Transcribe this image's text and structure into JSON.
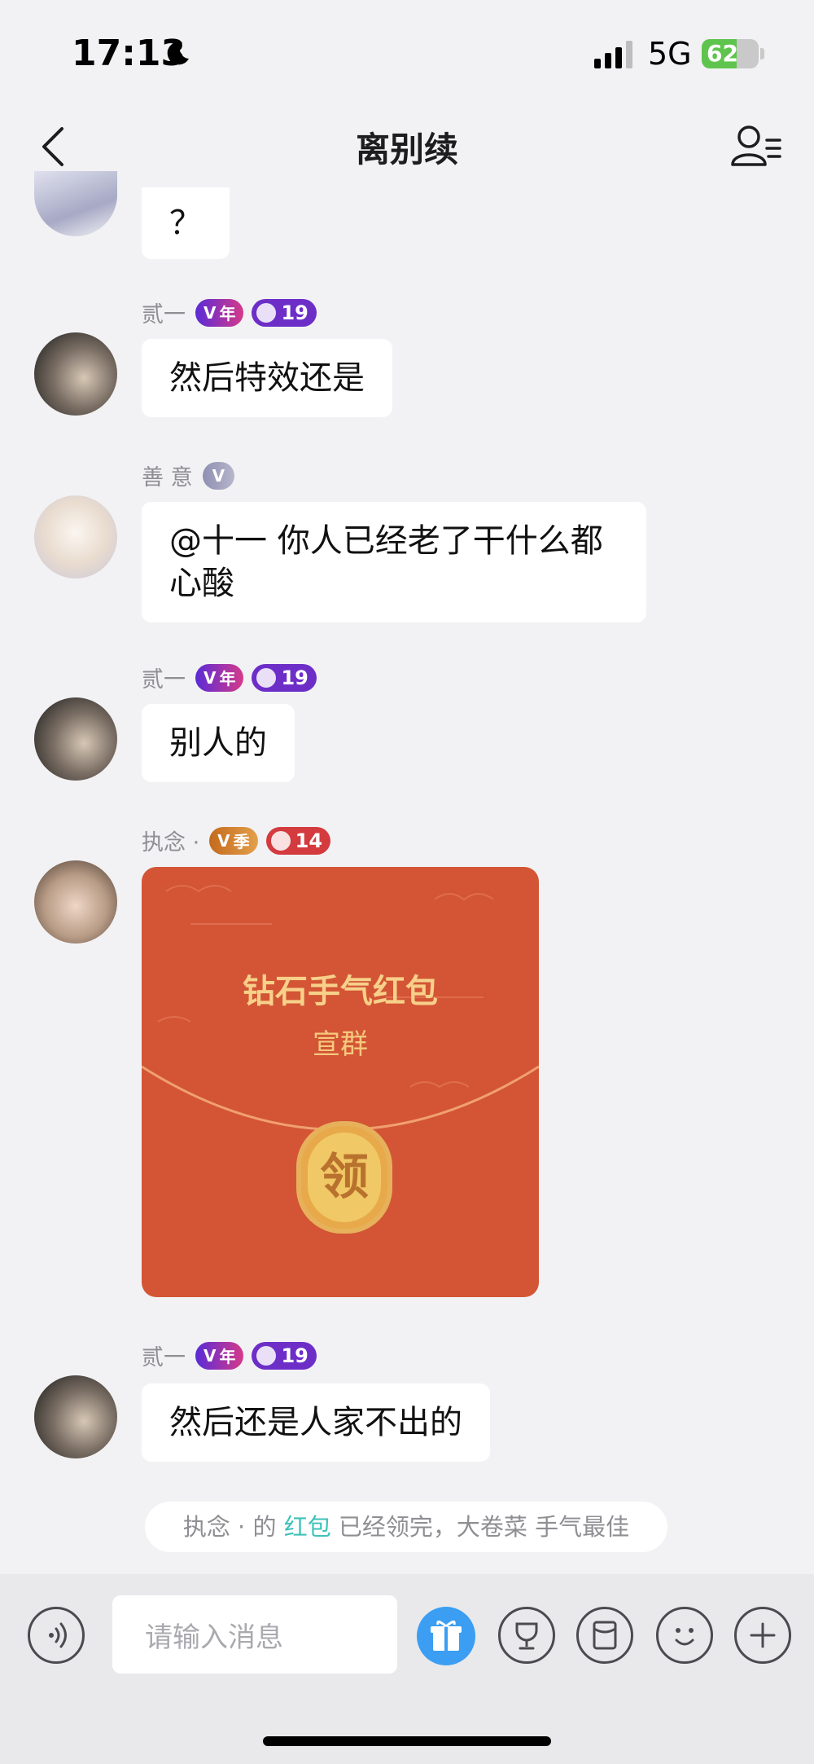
{
  "status_bar": {
    "time": "17:13",
    "network": "5G",
    "battery": "62"
  },
  "nav": {
    "title": "离别续"
  },
  "messages": [
    {
      "bubble": "？"
    },
    {
      "sender": "贰一",
      "vip_tag": "年",
      "level": "19",
      "bubble": "然后特效还是"
    },
    {
      "sender": "善 意",
      "bubble_l1": "@十一 你人已经老了干什么都",
      "bubble_l2": "心酸"
    },
    {
      "sender": "贰一",
      "vip_tag": "年",
      "level": "19",
      "bubble": "别人的"
    },
    {
      "sender": "执念 ·",
      "vip_tag": "季",
      "level": "14",
      "red_packet": {
        "title": "钻石手气红包",
        "subtitle": "宣群",
        "button": "领"
      }
    },
    {
      "sender": "贰一",
      "vip_tag": "年",
      "level": "19",
      "bubble": "然后还是人家不出的"
    }
  ],
  "notice": {
    "part1": "执念 · 的 ",
    "link": "红包",
    "part2": " 已经领完，大卷菜 手气最佳"
  },
  "input_bar": {
    "placeholder": "请输入消息"
  },
  "colors": {
    "red_packet": "#d35535",
    "accent_teal": "#3ec2b9",
    "gift_blue": "#3b9ef2"
  }
}
